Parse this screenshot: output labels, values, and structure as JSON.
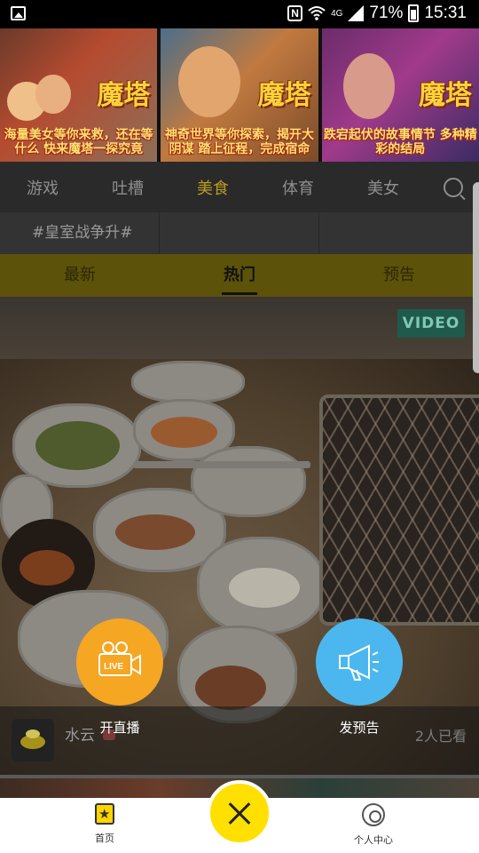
{
  "status_bar": {
    "nfc": "N",
    "network": "4G",
    "battery": "71%",
    "time": "15:31",
    "icons": [
      "gallery-icon",
      "nfc-icon",
      "wifi-icon",
      "signal-icon",
      "battery-icon"
    ]
  },
  "banner": {
    "brand": "魔塔",
    "panels": [
      {
        "caption": "海量美女等你来救，还在等什么 快来魔塔一探究竟"
      },
      {
        "caption": "神奇世界等你探索，揭开大阴谋 踏上征程，完成宿命"
      },
      {
        "caption": "跌宕起伏的故事情节 多种精彩的结局"
      }
    ]
  },
  "categories": {
    "items": [
      "游戏",
      "吐槽",
      "美食",
      "体育",
      "美女"
    ],
    "active_index": 2,
    "active_color": "#b99c1e"
  },
  "topics": [
    "#皇室战争升#",
    "",
    ""
  ],
  "subtabs": {
    "items": [
      "最新",
      "热门",
      "预告"
    ],
    "active_index": 1
  },
  "feed_card": {
    "badge": "VIDEO",
    "user_name": "水云",
    "views": "2人已看"
  },
  "actions": {
    "live": {
      "label": "开直播",
      "icon_text": "LIVE",
      "color": "#f5a623"
    },
    "preview": {
      "label": "发预告",
      "color": "#4cb7ee"
    }
  },
  "bottom_nav": {
    "home": "首页",
    "profile": "个人中心",
    "center_color": "#ffe000"
  }
}
